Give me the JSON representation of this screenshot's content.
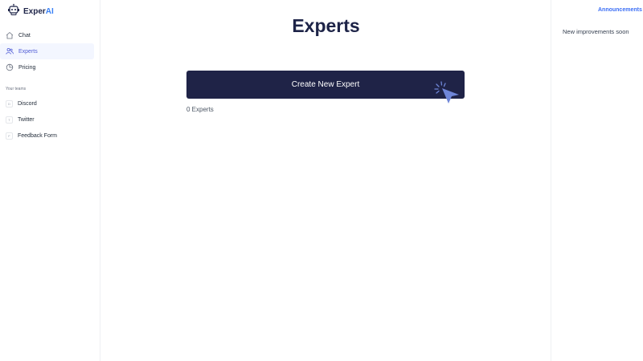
{
  "brand": {
    "name_main": "Exper",
    "name_accent": "AI"
  },
  "nav": [
    {
      "label": "Chat",
      "icon": "home-icon",
      "active": false
    },
    {
      "label": "Experts",
      "icon": "users-icon",
      "active": true
    },
    {
      "label": "Pricing",
      "icon": "pricing-icon",
      "active": false
    }
  ],
  "teams": {
    "section_label": "Your teams",
    "items": [
      {
        "badge": "D",
        "label": "Discord"
      },
      {
        "badge": "T",
        "label": "Twitter"
      },
      {
        "badge": "F",
        "label": "Feedback Form"
      }
    ]
  },
  "main": {
    "title": "Experts",
    "create_button_label": "Create New Expert",
    "count_text": "0 Experts"
  },
  "announcements": {
    "title": "Announcements",
    "text": "New improvements soon"
  },
  "colors": {
    "primary_dark": "#1f2347",
    "accent_blue": "#3b6ef5",
    "active_nav_bg": "#f3f6ff",
    "active_nav_text": "#4f5bd5"
  }
}
